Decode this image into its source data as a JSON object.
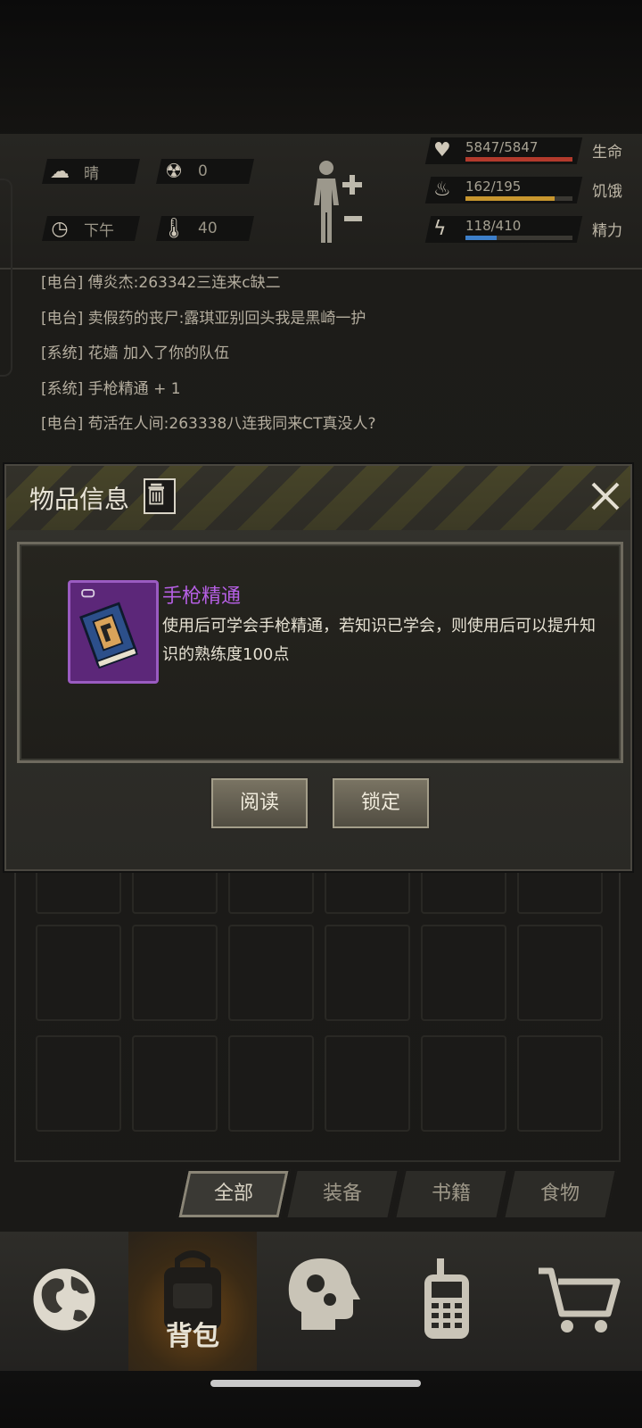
{
  "status": {
    "weather": {
      "icon": "cloud-sun-icon",
      "value": "晴"
    },
    "radiation": {
      "icon": "radiation-icon",
      "value": "0"
    },
    "time": {
      "icon": "clock-icon",
      "value": "下午"
    },
    "temperature": {
      "icon": "thermometer-icon",
      "value": "40"
    },
    "health": {
      "value": "5847/5847",
      "label": "生命",
      "fraction": 1.0,
      "color": "#b23a2c"
    },
    "hunger": {
      "value": "162/195",
      "label": "饥饿",
      "fraction": 0.83,
      "color": "#c7962e"
    },
    "energy": {
      "value": "118/410",
      "label": "精力",
      "fraction": 0.29,
      "color": "#3d7fc9"
    }
  },
  "chat": [
    "[电台] 傅炎杰:263342三连来c缺二",
    "[电台] 卖假药的丧尸:露琪亚别回头我是黑崎一护",
    "[系统] 花嫱 加入了你的队伍",
    "[系统] 手枪精通 + 1",
    "[电台] 苟活在人间:263338八连我同来CT真没人?"
  ],
  "modal": {
    "title": "物品信息",
    "item_name": "手枪精通",
    "item_desc": "使用后可学会手枪精通，若知识已学会，则使用后可以提升知识的熟练度100点",
    "read_label": "阅读",
    "lock_label": "锁定",
    "item_color": "#b55fe3"
  },
  "tabs": [
    "全部",
    "装备",
    "书籍",
    "食物"
  ],
  "nav": {
    "world": {
      "icon": "globe-icon"
    },
    "backpack": {
      "icon": "backpack-icon",
      "label": "背包"
    },
    "skills": {
      "icon": "head-gears-icon"
    },
    "radio": {
      "icon": "walkie-talkie-icon"
    },
    "shop": {
      "icon": "shopping-cart-icon"
    }
  }
}
